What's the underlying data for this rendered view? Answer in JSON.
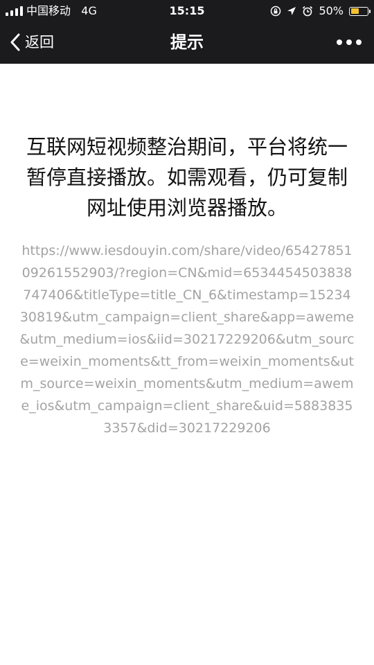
{
  "status_bar": {
    "carrier": "中国移动",
    "network": "4G",
    "time": "15:15",
    "battery_percent": "50%",
    "battery_level": 0.5,
    "battery_color": "#f2c230",
    "icons": [
      "signal-icon",
      "rotation-lock-icon",
      "location-arrow-icon",
      "alarm-icon",
      "battery-icon"
    ]
  },
  "nav": {
    "back_label": "返回",
    "title": "提示",
    "more_icon": "more-dots-icon",
    "background": "#1b1b1d"
  },
  "content": {
    "notice": "互联网短视频整治期间，平台将统一暂停直接播放。如需观看，仍可复制网址使用浏览器播放。",
    "url": "https://www.iesdouyin.com/share/video/6542785109261552903/?region=CN&mid=6534454503838747406&titleType=title_CN_6&timestamp=1523430819&utm_campaign=client_share&app=aweme&utm_medium=ios&iid=30217229206&utm_source=weixin_moments&tt_from=weixin_moments&utm_source=weixin_moments&utm_medium=aweme_ios&utm_campaign=client_share&uid=58838353357&did=30217229206"
  }
}
